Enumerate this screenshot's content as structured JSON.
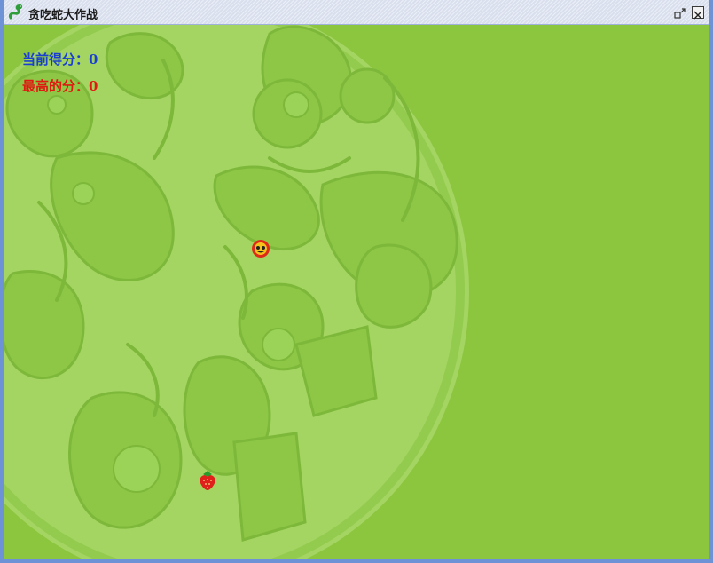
{
  "window": {
    "title": "贪吃蛇大作战",
    "app_icon": "snake-app-icon",
    "controls": [
      "restore-icon",
      "close-icon"
    ]
  },
  "scoreboard": {
    "current_label": "当前得分：",
    "current_value": "0",
    "best_label": "最高的分：",
    "best_value": "0"
  },
  "game": {
    "snake_head_icon": "snake-head-icon",
    "food_icon": "strawberry-icon"
  },
  "colors": {
    "background_green": "#8cc63f",
    "art_green": "#a9d86a",
    "current_score_color": "#1a3fd0",
    "best_score_color": "#e01a10",
    "window_border": "#6d93d6"
  }
}
